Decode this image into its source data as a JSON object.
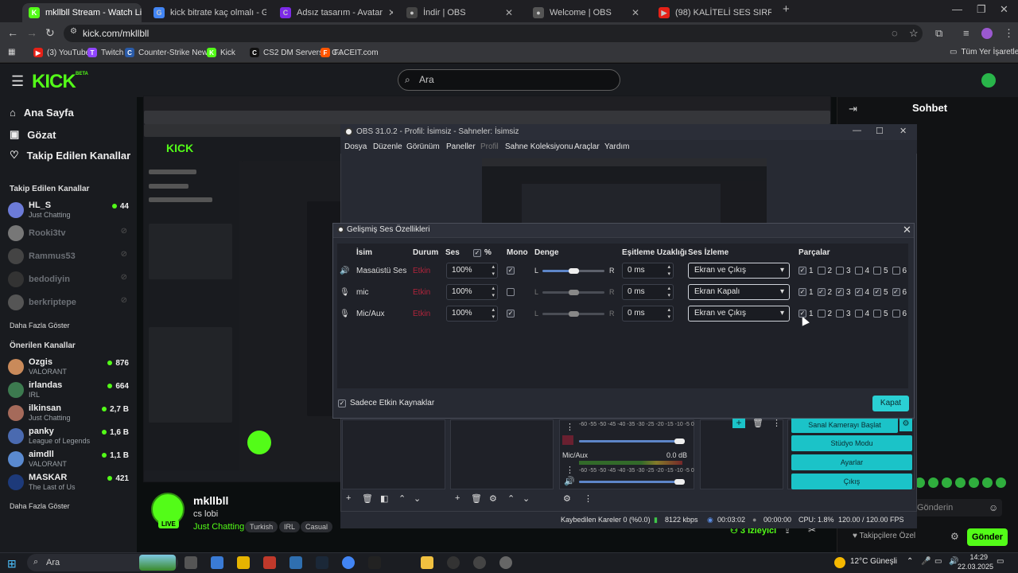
{
  "browser": {
    "tabs": [
      {
        "label": "mkllbll Stream - Watch Live on",
        "fav": "K",
        "fav_color": "#53fc18",
        "active": true
      },
      {
        "label": "kick bitrate kaç olmalı - Google",
        "fav": "G",
        "fav_color": "#4285f4",
        "active": false
      },
      {
        "label": "Adsız tasarım - Avatar",
        "fav": "C",
        "fav_color": "#7d2ae8",
        "active": false
      },
      {
        "label": "İndir | OBS",
        "fav": "●",
        "fav_color": "#444",
        "active": false
      },
      {
        "label": "Welcome | OBS",
        "fav": "●",
        "fav_color": "#555",
        "active": false
      },
      {
        "label": "(98) KALİTELİ SES SIRRI - Obs S",
        "fav": "▶",
        "fav_color": "#e62117",
        "active": false
      }
    ],
    "new_tab": "+",
    "url": "kick.com/mkllbll",
    "bookmarks": [
      {
        "label": "(3) YouTube",
        "fav_color": "#e62117",
        "fav": "▶"
      },
      {
        "label": "Twitch",
        "fav_color": "#9146ff",
        "fav": "T"
      },
      {
        "label": "Counter-Strike New...",
        "fav_color": "#2a5ba8",
        "fav": "C"
      },
      {
        "label": "Kick",
        "fav_color": "#53fc18",
        "fav": "K"
      },
      {
        "label": "CS2 DM Servers – C...",
        "fav_color": "#111",
        "fav": "C"
      },
      {
        "label": "FACEIT.com",
        "fav_color": "#ff5500",
        "fav": "F"
      }
    ],
    "all_bookmarks": "Tüm Yer İşaretleri"
  },
  "kick": {
    "logo": "KICK",
    "beta": "BETA",
    "search_placeholder": "Ara",
    "nav": [
      {
        "label": "Ana Sayfa",
        "icon": "home-icon",
        "glyph": "⌂"
      },
      {
        "label": "Gözat",
        "icon": "browse-icon",
        "glyph": "▣"
      },
      {
        "label": "Takip Edilen Kanallar",
        "icon": "heart-icon",
        "glyph": "♡"
      }
    ],
    "followed_header": "Takip Edilen Kanallar",
    "followed": [
      {
        "name": "HL_S",
        "sub": "Just Chatting",
        "viewers": "44",
        "online": true,
        "color": "#6c7bd8"
      },
      {
        "name": "Rooki3tv",
        "sub": "",
        "viewers": "",
        "online": false,
        "color": "#777"
      },
      {
        "name": "Rammus53",
        "sub": "",
        "viewers": "",
        "online": false,
        "color": "#444"
      },
      {
        "name": "bedodiyin",
        "sub": "",
        "viewers": "",
        "online": false,
        "color": "#333"
      },
      {
        "name": "berkriptepe",
        "sub": "",
        "viewers": "",
        "online": false,
        "color": "#555"
      }
    ],
    "show_more": "Daha Fazla Göster",
    "recommended_header": "Önerilen Kanallar",
    "recommended": [
      {
        "name": "Ozgis",
        "sub": "VALORANT",
        "viewers": "876",
        "color": "#c98a5a"
      },
      {
        "name": "irlandas",
        "sub": "IRL",
        "viewers": "664",
        "color": "#3c7a4f"
      },
      {
        "name": "ilkinsan",
        "sub": "Just Chatting",
        "viewers": "2,7 B",
        "color": "#a56a5a"
      },
      {
        "name": "panky",
        "sub": "League of Legends",
        "viewers": "1,6 B",
        "color": "#4a6ab0"
      },
      {
        "name": "aimdll",
        "sub": "VALORANT",
        "viewers": "1,1 B",
        "color": "#5a8ad0"
      },
      {
        "name": "MASKAR",
        "sub": "The Last of Us",
        "viewers": "421",
        "color": "#1d3a7a"
      }
    ],
    "show_more_2": "Daha Fazla Göster",
    "streamer": {
      "name": "mkllbll",
      "title": "cs lobi",
      "category": "Just Chatting",
      "live": "LIVE",
      "tags": [
        "Turkish",
        "IRL",
        "Casual"
      ]
    },
    "viewers_now": "3 İzleyici",
    "chat": {
      "title": "Sohbet",
      "placeholder": "Gönderin",
      "send": "Gönder",
      "follow_only": "Takipçilere Özel"
    }
  },
  "obs": {
    "title": "OBS 31.0.2 - Profil: İsimsiz - Sahneler: İsimsiz",
    "menu": [
      "Dosya",
      "Düzenle",
      "Görünüm",
      "Paneller",
      "Profil",
      "Sahne Koleksiyonu",
      "Araçlar",
      "Yardım"
    ],
    "mixer_mic_label": "Mic/Aux",
    "mixer_mic_db": "0.0 dB",
    "buttons": [
      "Sanal Kamerayı Başlat",
      "Stüdyo Modu",
      "Ayarlar",
      "Çıkış"
    ],
    "status": {
      "dropped": "Kaybedilen Kareler 0 (%0.0)",
      "bitrate": "8122 kbps",
      "live_time": "00:03:02",
      "rec_time": "00:00:00",
      "cpu": "CPU: 1.8%",
      "fps": "120.00 / 120.00 FPS"
    }
  },
  "dialog": {
    "title": "Gelişmiş Ses Özellikleri",
    "headers": {
      "name": "İsim",
      "status": "Durum",
      "volume": "Ses",
      "percent": "%",
      "mono": "Mono",
      "balance": "Denge",
      "sync": "Eşitleme Uzaklığı",
      "monitor": "Ses İzleme",
      "tracks": "Parçalar"
    },
    "balance_left": "L",
    "balance_right": "R",
    "rows": [
      {
        "name": "Masaüstü Ses",
        "icon": "speaker-icon",
        "status": "Etkin",
        "volume": "100%",
        "mono": true,
        "sync": "0 ms",
        "monitor": "Ekran ve Çıkış",
        "tracks": [
          true,
          false,
          false,
          false,
          false,
          false
        ]
      },
      {
        "name": "mic",
        "icon": "mic-icon",
        "status": "Etkin",
        "volume": "100%",
        "mono": false,
        "sync": "0 ms",
        "monitor": "Ekran Kapalı",
        "tracks": [
          true,
          true,
          true,
          true,
          true,
          true
        ]
      },
      {
        "name": "Mic/Aux",
        "icon": "mic-icon",
        "status": "Etkin",
        "volume": "100%",
        "mono": true,
        "sync": "0 ms",
        "monitor": "Ekran ve Çıkış",
        "tracks": [
          true,
          false,
          false,
          false,
          false,
          false
        ]
      }
    ],
    "track_numbers": [
      "1",
      "2",
      "3",
      "4",
      "5",
      "6"
    ],
    "only_active": "Sadece Etkin Kaynaklar",
    "close": "Kapat"
  },
  "taskbar": {
    "search_placeholder": "Ara",
    "weather": "12°C  Güneşli",
    "time": "14:29",
    "date": "22.03.2025"
  }
}
